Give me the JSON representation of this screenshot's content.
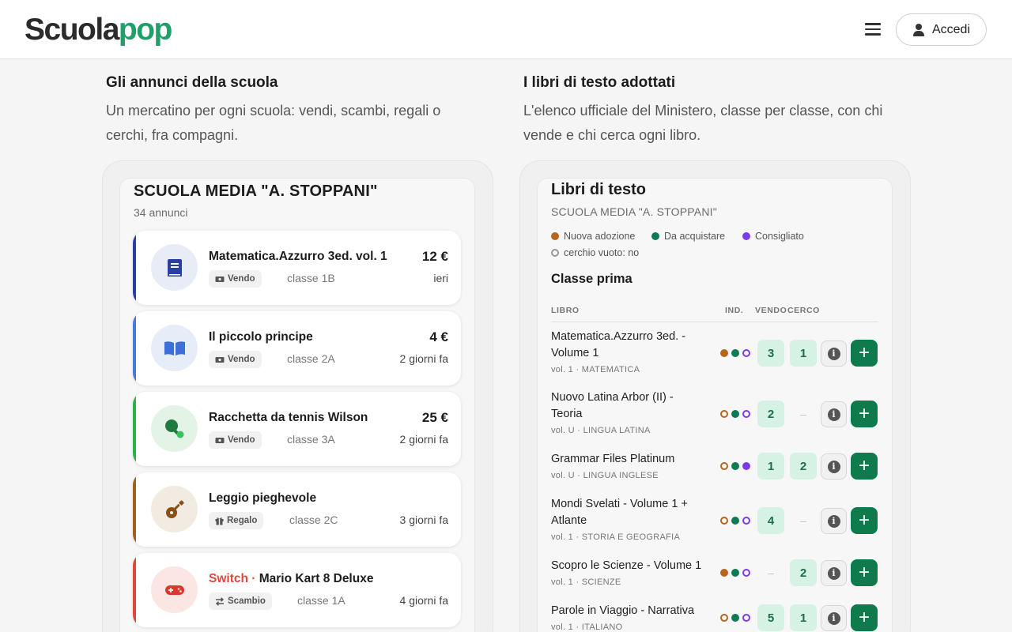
{
  "header": {
    "logo_part1": "Scu",
    "logo_part2": "o",
    "logo_part3": "la",
    "logo_part4": "pop",
    "login_label": "Accedi"
  },
  "colors": {
    "brand_green": "#1fa06a",
    "action_green": "#0f7a4b",
    "count_bg": "#d6f2e4",
    "nuova_adozione": "#b5651d",
    "da_acquistare": "#0f7a56",
    "consigliato": "#7c3aed"
  },
  "ads_section": {
    "title": "Gli annunci della scuola",
    "subtitle": "Un mercatino per ogni scuola: vendi, scambi, regali o cerchi, fra compagni."
  },
  "books_section": {
    "title": "I libri di testo adottati",
    "subtitle": "L'elenco ufficiale del Ministero, classe per classe, con chi vende e chi cerca ogni libro."
  },
  "ads_panel": {
    "school": "SCUOLA MEDIA \"A. STOPPANI\"",
    "count": "34 annunci",
    "ads": [
      {
        "title": "Matematica.Azzurro 3ed. vol. 1",
        "brand": "",
        "tag": "Vendo",
        "tag_icon": "banknote-icon",
        "class": "classe 1B",
        "price": "12 €",
        "when": "ieri",
        "icon": "book-icon",
        "accent": "#2a3f9f",
        "icon_bg": "#e8ecf6"
      },
      {
        "title": "Il piccolo principe",
        "brand": "",
        "tag": "Vendo",
        "tag_icon": "banknote-icon",
        "class": "classe 2A",
        "price": "4 €",
        "when": "2 giorni fa",
        "icon": "open-book-icon",
        "accent": "#4a78d8",
        "icon_bg": "#e6edf9"
      },
      {
        "title": "Racchetta da tennis Wilson",
        "brand": "",
        "tag": "Vendo",
        "tag_icon": "banknote-icon",
        "class": "classe 3A",
        "price": "25 €",
        "when": "2 giorni fa",
        "icon": "ping-pong-icon",
        "accent": "#2fb04f",
        "icon_bg": "#e3f4e6"
      },
      {
        "title": "Leggio pieghevole",
        "brand": "",
        "tag": "Regalo",
        "tag_icon": "gift-icon",
        "class": "classe 2C",
        "price": "",
        "when": "3 giorni fa",
        "icon": "guitar-icon",
        "accent": "#a0601e",
        "icon_bg": "#f2ebe2"
      },
      {
        "title": "Mario Kart 8 Deluxe",
        "brand": "Switch ·",
        "tag": "Scambio",
        "tag_icon": "swap-icon",
        "class": "classe 1A",
        "price": "",
        "when": "4 giorni fa",
        "icon": "gamepad-icon",
        "accent": "#e0463a",
        "icon_bg": "#fbe6e4"
      }
    ]
  },
  "books_panel": {
    "title": "Libri di testo",
    "school": "SCUOLA MEDIA \"A. STOPPANI\"",
    "legend": {
      "nuova": "Nuova adozione",
      "acquistare": "Da acquistare",
      "consigliato": "Consigliato",
      "vuoto": "cerchio vuoto: no"
    },
    "class_title": "Classe prima",
    "headers": {
      "libro": "LIBRO",
      "ind": "IND.",
      "vendo": "VENDO",
      "cerco": "CERCO"
    },
    "books": [
      {
        "name": "Matematica.Azzurro 3ed. - Volume 1",
        "meta": "vol. 1 · MATEMATICA",
        "nuova": true,
        "acquistare": true,
        "consigliato": false,
        "vendo": "3",
        "cerco": "1"
      },
      {
        "name": "Nuovo Latina Arbor (II) - Teoria",
        "meta": "vol. U · LINGUA LATINA",
        "nuova": false,
        "acquistare": true,
        "consigliato": false,
        "vendo": "2",
        "cerco": "–"
      },
      {
        "name": "Grammar Files Platinum",
        "meta": "vol. U · LINGUA INGLESE",
        "nuova": false,
        "acquistare": true,
        "consigliato": true,
        "vendo": "1",
        "cerco": "2"
      },
      {
        "name": "Mondi Svelati - Volume 1 + Atlante",
        "meta": "vol. 1 · STORIA E GEOGRAFIA",
        "nuova": false,
        "acquistare": true,
        "consigliato": false,
        "vendo": "4",
        "cerco": "–"
      },
      {
        "name": "Scopro le Scienze - Volume 1",
        "meta": "vol. 1 · SCIENZE",
        "nuova": true,
        "acquistare": true,
        "consigliato": false,
        "vendo": "–",
        "cerco": "2"
      },
      {
        "name": "Parole in Viaggio - Narrativa",
        "meta": "vol. 1 · ITALIANO",
        "nuova": false,
        "acquistare": true,
        "consigliato": false,
        "vendo": "5",
        "cerco": "1"
      }
    ]
  }
}
